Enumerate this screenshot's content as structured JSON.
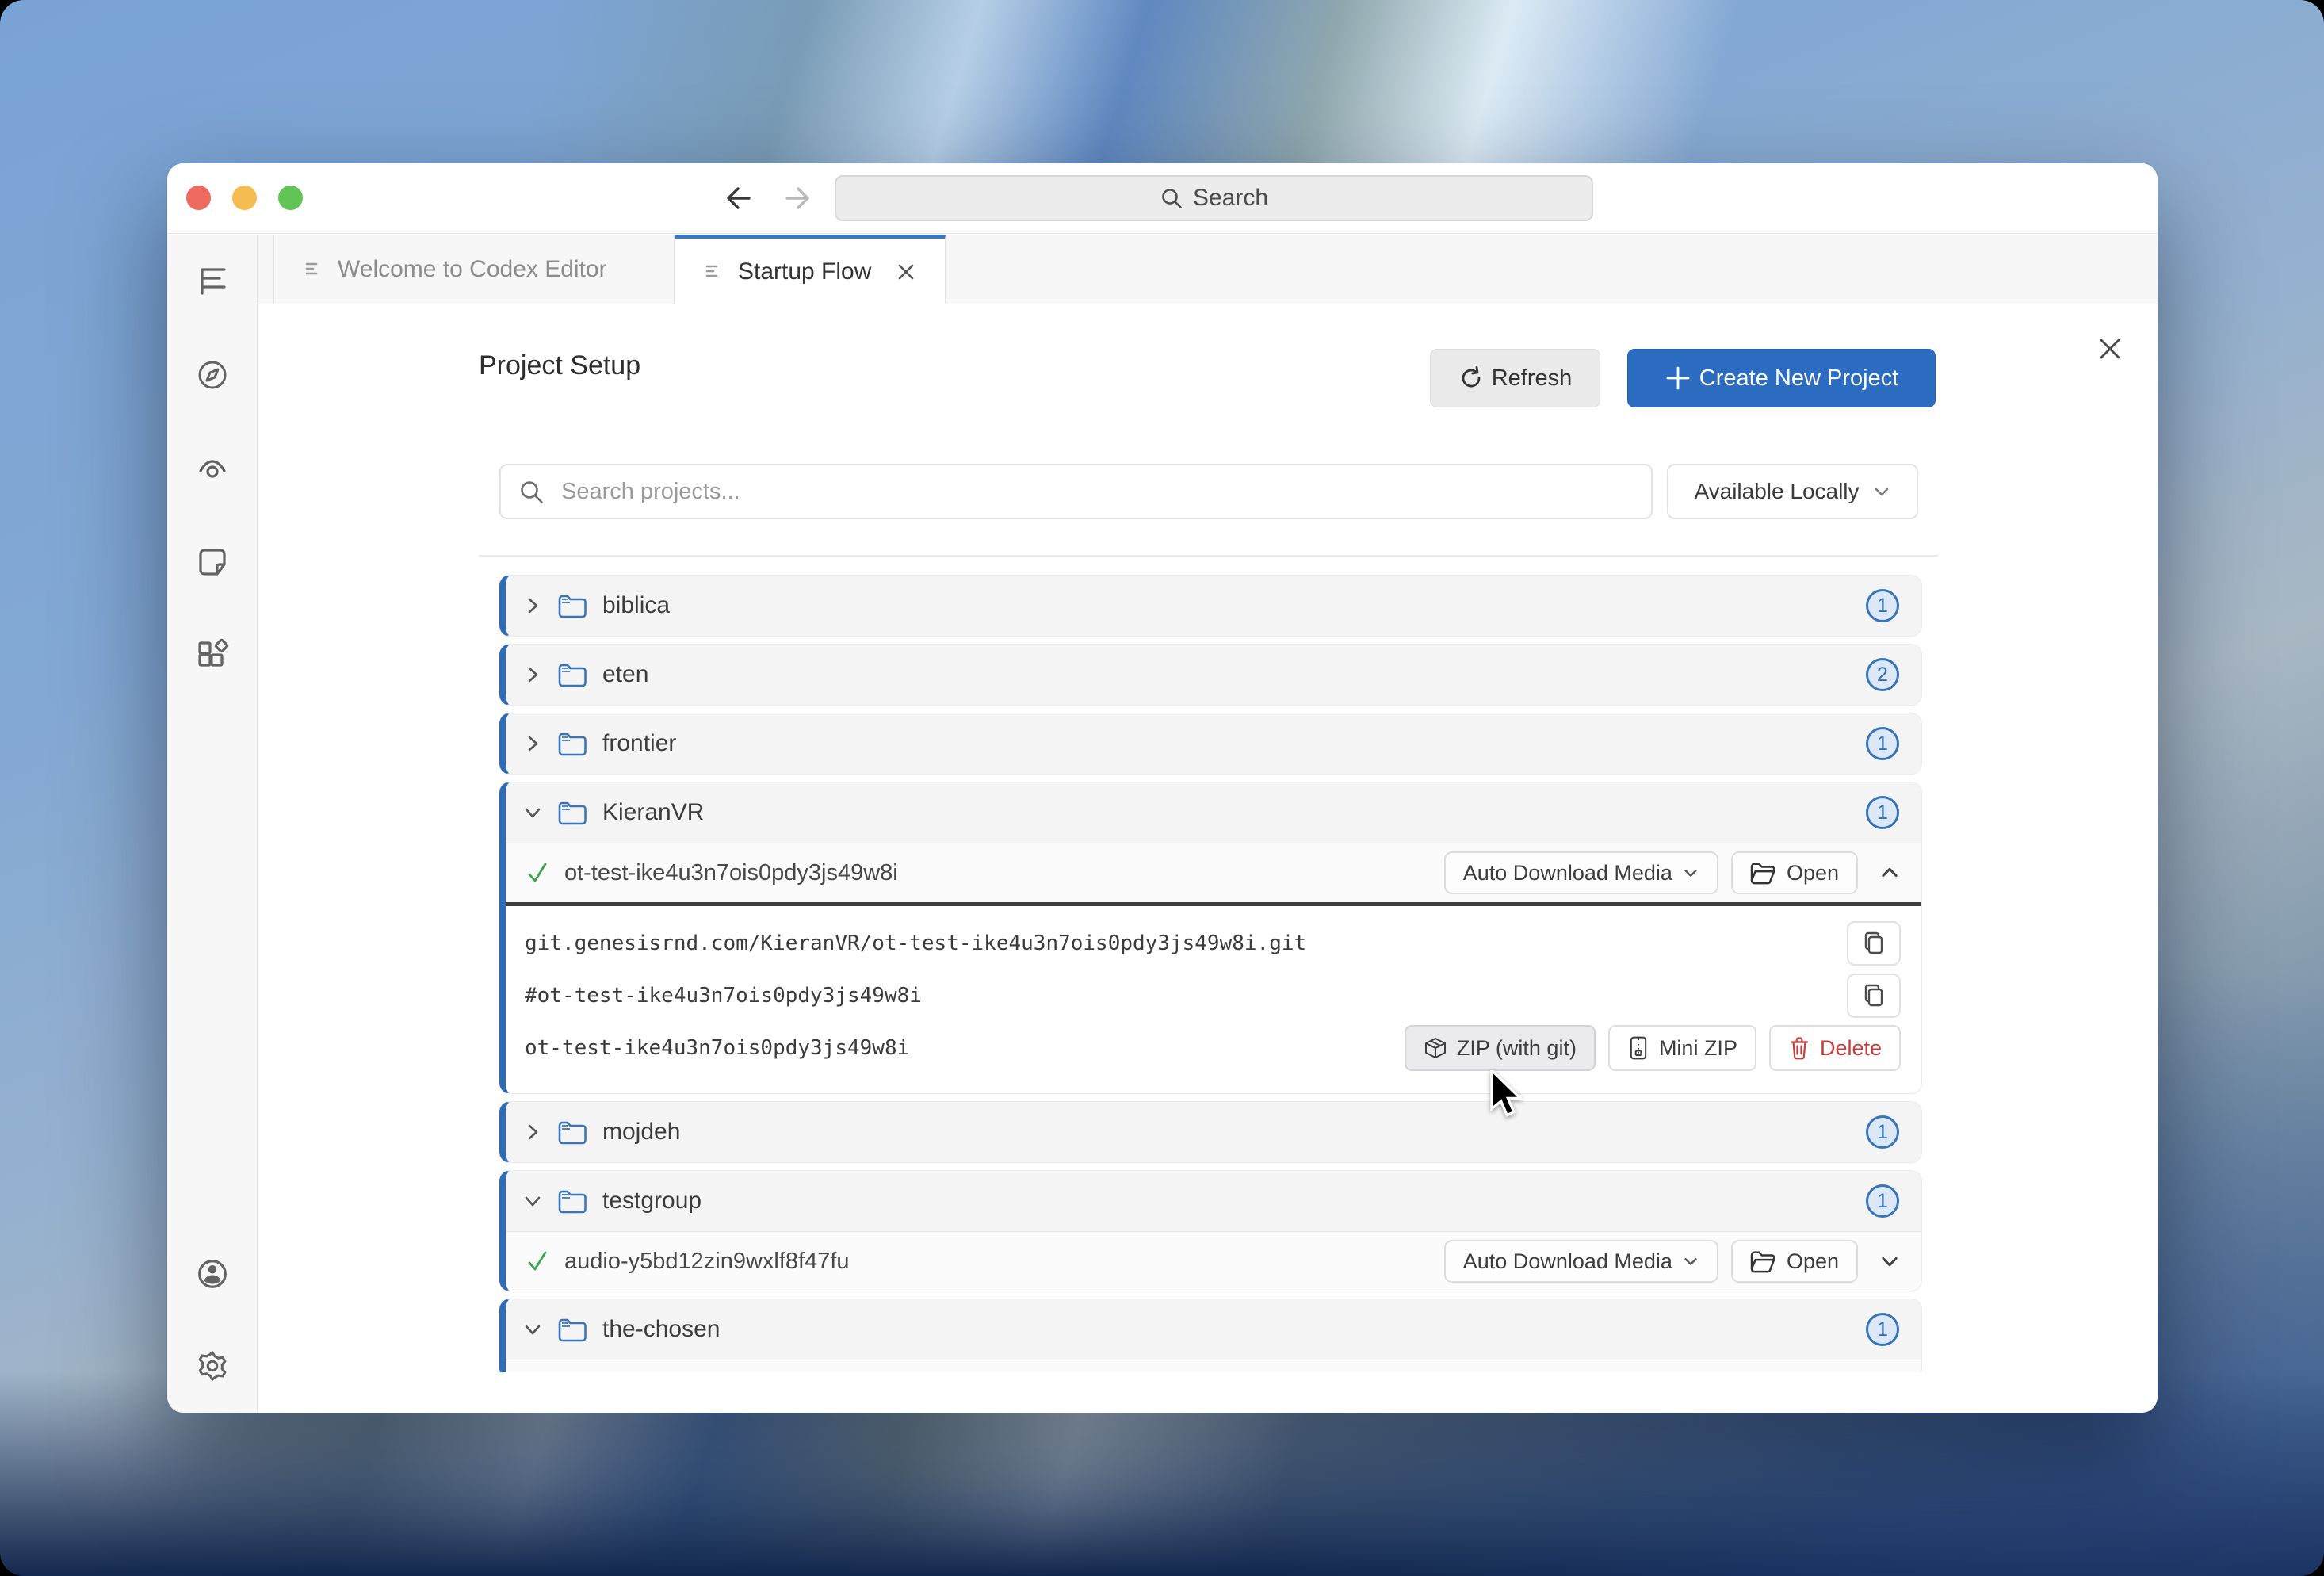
{
  "colors": {
    "accent_blue": "#2e6cb5",
    "primary_button": "#2b6cc1",
    "active_tab_border": "#3677c5",
    "badge_border": "#3874b8",
    "badge_bg": "#dce8f7",
    "delete_red": "#c43c3c",
    "check_green": "#3aa34d",
    "traffic_red": "#ee6a5f",
    "traffic_yellow": "#f5bd4f",
    "traffic_green": "#61c455"
  },
  "titlebar": {
    "search_placeholder": "Search"
  },
  "tabs": [
    {
      "label": "Welcome to Codex Editor",
      "active": false
    },
    {
      "label": "Startup Flow",
      "active": true
    }
  ],
  "sidebar": {
    "items": [
      {
        "icon": "outline-tree-icon"
      },
      {
        "icon": "compass-icon"
      },
      {
        "icon": "eye-preview-icon"
      },
      {
        "icon": "sticky-note-icon"
      },
      {
        "icon": "extensions-icon"
      },
      {
        "icon": "account-icon"
      },
      {
        "icon": "settings-gear-icon"
      }
    ]
  },
  "panel": {
    "title": "Project Setup",
    "refresh_label": "Refresh",
    "create_label": "Create New Project",
    "search_placeholder": "Search projects...",
    "filter_value": "Available Locally"
  },
  "labels": {
    "auto_download_media": "Auto Download Media",
    "open": "Open",
    "zip_with_git": "ZIP (with git)",
    "mini_zip": "Mini ZIP",
    "delete": "Delete"
  },
  "projects": [
    {
      "name": "biblica",
      "count": 1,
      "expanded": false
    },
    {
      "name": "eten",
      "count": 2,
      "expanded": false
    },
    {
      "name": "frontier",
      "count": 1,
      "expanded": false
    },
    {
      "name": "KieranVR",
      "count": 1,
      "expanded": true,
      "entry": {
        "name": "ot-test-ike4u3n7ois0pdy3js49w8i",
        "synced": true,
        "details_expanded": true,
        "details": {
          "git_url": "git.genesisrnd.com/KieranVR/ot-test-ike4u3n7ois0pdy3js49w8i.git",
          "ref": "#ot-test-ike4u3n7ois0pdy3js49w8i",
          "project_id": "ot-test-ike4u3n7ois0pdy3js49w8i"
        }
      }
    },
    {
      "name": "mojdeh",
      "count": 1,
      "expanded": false
    },
    {
      "name": "testgroup",
      "count": 1,
      "expanded": true,
      "entry": {
        "name": "audio-y5bd12zin9wxlf8f47fu",
        "synced": true,
        "details_expanded": false
      }
    },
    {
      "name": "the-chosen",
      "count": 1,
      "expanded": true
    }
  ]
}
